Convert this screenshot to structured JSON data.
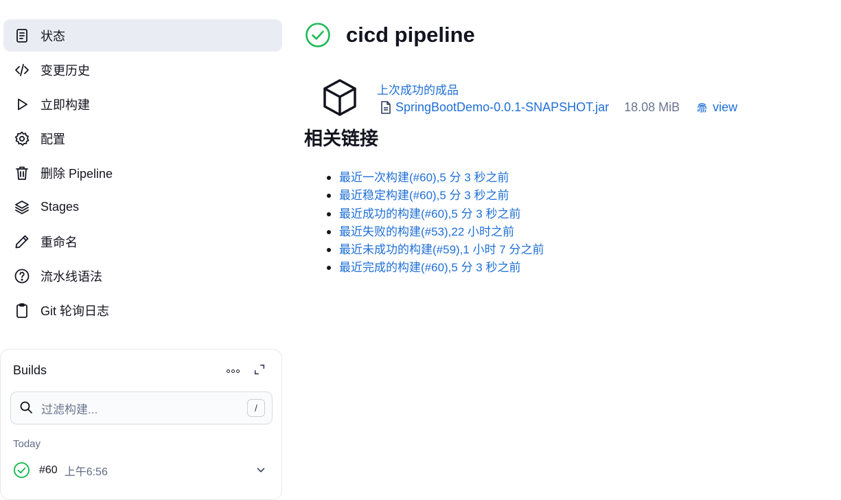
{
  "sidebar": {
    "items": [
      {
        "label": "状态",
        "icon": "document-icon",
        "active": true
      },
      {
        "label": "变更历史",
        "icon": "code-icon"
      },
      {
        "label": "立即构建",
        "icon": "play-icon"
      },
      {
        "label": "配置",
        "icon": "gear-icon"
      },
      {
        "label": "删除 Pipeline",
        "icon": "trash-icon"
      },
      {
        "label": "Stages",
        "icon": "layers-icon"
      },
      {
        "label": "重命名",
        "icon": "pencil-icon"
      },
      {
        "label": "流水线语法",
        "icon": "help-circle-icon"
      },
      {
        "label": "Git 轮询日志",
        "icon": "clipboard-icon"
      }
    ]
  },
  "builds": {
    "title": "Builds",
    "search_placeholder": "过滤构建...",
    "search_shortcut": "/",
    "group_label": "Today",
    "rows": [
      {
        "number": "#60",
        "time": "上午6:56",
        "status": "success"
      }
    ]
  },
  "main": {
    "title": "cicd pipeline",
    "status": "success",
    "artifact": {
      "heading": "上次成功的成品",
      "file_name": "SpringBootDemo-0.0.1-SNAPSHOT.jar",
      "file_size": "18.08 MiB",
      "view_label": "view"
    },
    "links_heading": "相关链接",
    "links": [
      "最近一次构建(#60),5 分 3 秒之前",
      "最近稳定构建(#60),5 分 3 秒之前",
      "最近成功的构建(#60),5 分 3 秒之前",
      "最近失败的构建(#53),22 小时之前",
      "最近未成功的构建(#59),1 小时 7 分之前",
      "最近完成的构建(#60),5 分 3 秒之前"
    ]
  },
  "colors": {
    "success": "#1db954",
    "link": "#1f6fd6",
    "active_bg": "#e9edf3"
  }
}
